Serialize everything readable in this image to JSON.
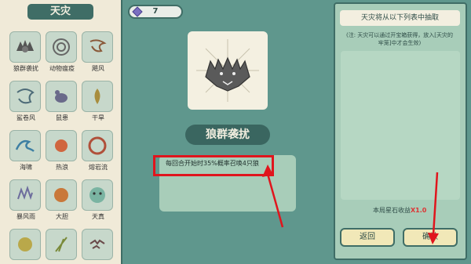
{
  "left_panel": {
    "title": "天灾",
    "items": [
      {
        "label": "狼群袭扰",
        "icon": "wolf-pack-icon"
      },
      {
        "label": "动物瘟疫",
        "icon": "animal-plague-icon"
      },
      {
        "label": "飓风",
        "icon": "hurricane-icon"
      },
      {
        "label": "鲨卷风",
        "icon": "shark-tornado-icon"
      },
      {
        "label": "鼠患",
        "icon": "rat-plague-icon"
      },
      {
        "label": "干旱",
        "icon": "drought-icon"
      },
      {
        "label": "海啸",
        "icon": "tsunami-icon"
      },
      {
        "label": "热浪",
        "icon": "heat-wave-icon"
      },
      {
        "label": "熔岩流",
        "icon": "lava-flow-icon"
      },
      {
        "label": "暴风雨",
        "icon": "storm-icon"
      },
      {
        "label": "大胆",
        "icon": "bold-creature-icon"
      },
      {
        "label": "天真",
        "icon": "naive-face-icon"
      },
      {
        "label": "",
        "icon": "sun-orb-icon"
      },
      {
        "label": "",
        "icon": "bamboo-icon"
      },
      {
        "label": "",
        "icon": "bird-flock-icon"
      }
    ]
  },
  "top": {
    "gem_count": "7",
    "gem_icon": "purple-gem-icon"
  },
  "center": {
    "card_icon": "three-headed-wolf-icon",
    "name": "狼群袭扰",
    "description": "每回合开始时35%概率召唤4只狼"
  },
  "right_panel": {
    "title": "天灾将从以下列表中抽取",
    "note": "(注: 天灾可以通过开宝箱获得，放入[天灾的牢笼]中才会生效)",
    "earnings_label": "本局星石收益",
    "earnings_value": "X1.0",
    "back_label": "返回",
    "confirm_label": "确认"
  },
  "colors": {
    "panel_bg": "#f0ead8",
    "accent_dark": "#3f6d66",
    "mint": "#a8cdb9",
    "highlight_red": "#e0151d",
    "button_bg": "#f1e8b8"
  }
}
